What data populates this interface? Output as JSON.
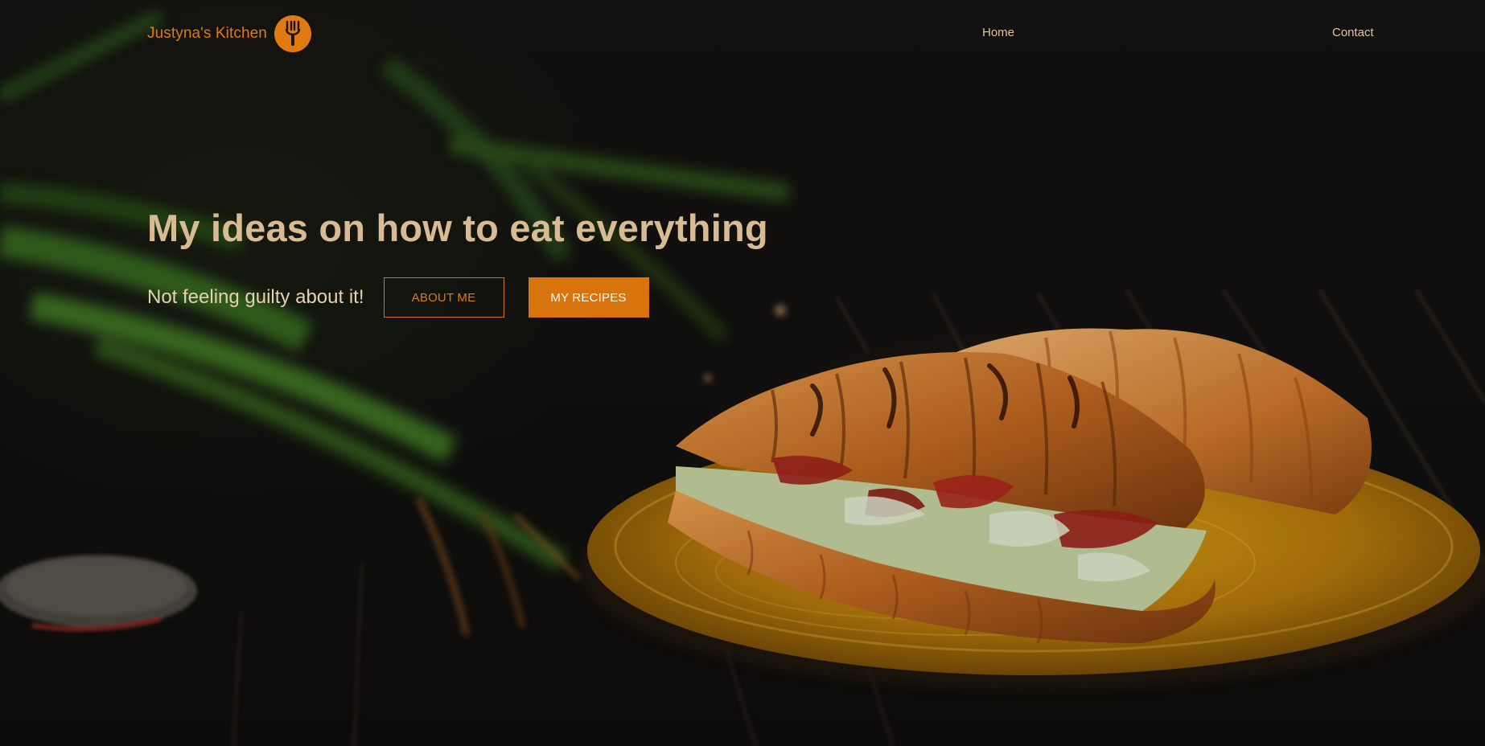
{
  "brand": {
    "name": "Justyna's Kitchen",
    "logo_icon": "fork-icon"
  },
  "nav": {
    "home": "Home",
    "contact": "Contact"
  },
  "hero": {
    "headline": "My ideas on how to eat everything",
    "subtitle": "Not feeling guilty about it!",
    "about_button": "ABOUT ME",
    "recipes_button": "MY RECIPES",
    "background_image": "croissant-sandwiches-on-plate-photo"
  },
  "colors": {
    "accent": "#e07a10",
    "headline": "#d9bb93",
    "nav_text": "#e2c59c",
    "background": "#141210"
  }
}
